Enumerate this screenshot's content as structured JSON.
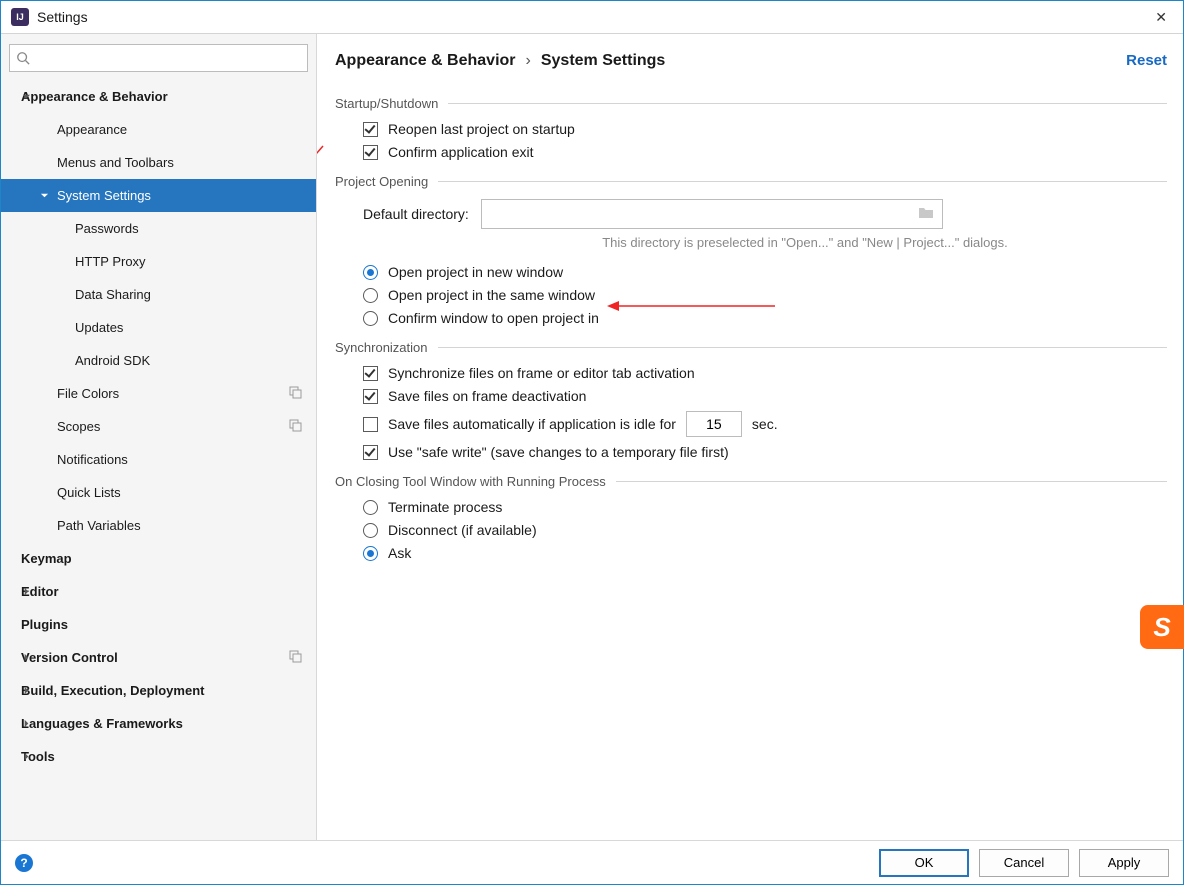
{
  "window": {
    "title": "Settings"
  },
  "sidebar": {
    "search_placeholder": "",
    "items": [
      {
        "label": "Appearance & Behavior",
        "bold": true,
        "expanded": true,
        "caret": "down",
        "lvl": 0
      },
      {
        "label": "Appearance",
        "lvl": 1
      },
      {
        "label": "Menus and Toolbars",
        "lvl": 1
      },
      {
        "label": "System Settings",
        "lvl": 1,
        "expanded": true,
        "caret": "down",
        "selected": true
      },
      {
        "label": "Passwords",
        "lvl": 2
      },
      {
        "label": "HTTP Proxy",
        "lvl": 2
      },
      {
        "label": "Data Sharing",
        "lvl": 2
      },
      {
        "label": "Updates",
        "lvl": 2
      },
      {
        "label": "Android SDK",
        "lvl": 2
      },
      {
        "label": "File Colors",
        "lvl": 1,
        "copy": true
      },
      {
        "label": "Scopes",
        "lvl": 1,
        "copy": true
      },
      {
        "label": "Notifications",
        "lvl": 1
      },
      {
        "label": "Quick Lists",
        "lvl": 1
      },
      {
        "label": "Path Variables",
        "lvl": 1
      },
      {
        "label": "Keymap",
        "bold": true,
        "lvl": 0
      },
      {
        "label": "Editor",
        "bold": true,
        "caret": "right",
        "lvl": 0
      },
      {
        "label": "Plugins",
        "bold": true,
        "lvl": 0
      },
      {
        "label": "Version Control",
        "bold": true,
        "caret": "right",
        "lvl": 0,
        "copy": true
      },
      {
        "label": "Build, Execution, Deployment",
        "bold": true,
        "caret": "right",
        "lvl": 0
      },
      {
        "label": "Languages & Frameworks",
        "bold": true,
        "caret": "right",
        "lvl": 0
      },
      {
        "label": "Tools",
        "bold": true,
        "caret": "right",
        "lvl": 0
      }
    ]
  },
  "breadcrumb": {
    "root": "Appearance & Behavior",
    "leaf": "System Settings"
  },
  "reset_label": "Reset",
  "sections": {
    "startup": {
      "title": "Startup/Shutdown",
      "reopen": {
        "label": "Reopen last project on startup",
        "checked": true
      },
      "confirm_exit": {
        "label": "Confirm application exit",
        "checked": true
      }
    },
    "project_opening": {
      "title": "Project Opening",
      "default_dir_label": "Default directory:",
      "default_dir_value": "",
      "hint": "This directory is preselected in \"Open...\" and \"New | Project...\" dialogs.",
      "radios": {
        "new_window": "Open project in new window",
        "same_window": "Open project in the same window",
        "confirm": "Confirm window to open project in",
        "selected": "new_window"
      }
    },
    "sync": {
      "title": "Synchronization",
      "sync_on_frame": {
        "label": "Synchronize files on frame or editor tab activation",
        "checked": true
      },
      "save_on_deact": {
        "label": "Save files on frame deactivation",
        "checked": true
      },
      "save_idle": {
        "label_before": "Save files automatically if application is idle for",
        "value": "15",
        "label_after": "sec.",
        "checked": false
      },
      "safe_write": {
        "label": "Use \"safe write\" (save changes to a temporary file first)",
        "checked": true
      }
    },
    "closing": {
      "title": "On Closing Tool Window with Running Process",
      "radios": {
        "terminate": "Terminate process",
        "disconnect": "Disconnect (if available)",
        "ask": "Ask",
        "selected": "ask"
      }
    }
  },
  "footer": {
    "ok": "OK",
    "cancel": "Cancel",
    "apply": "Apply"
  },
  "badge": "S"
}
